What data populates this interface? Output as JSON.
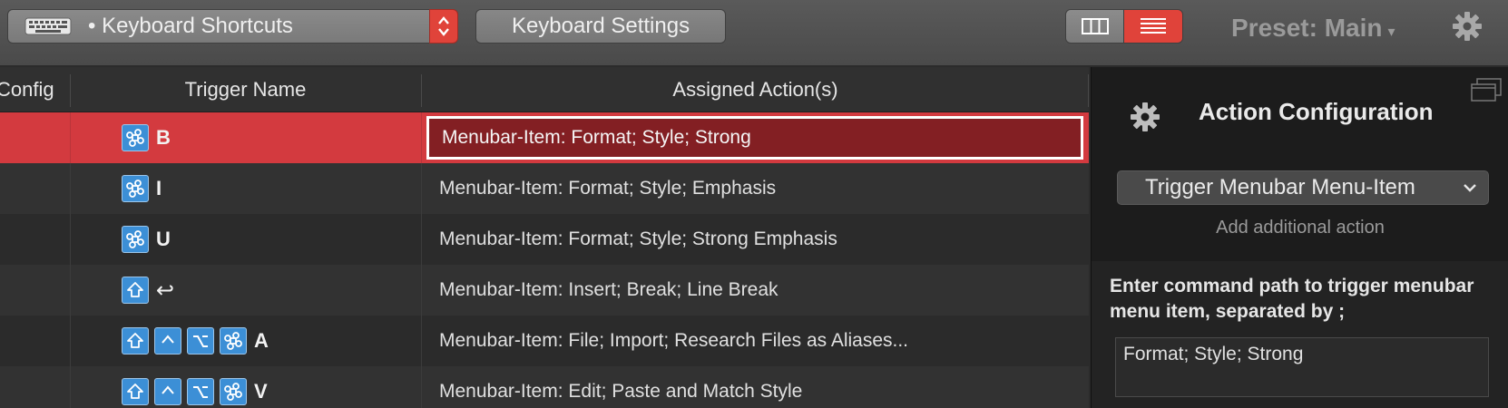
{
  "toolbar": {
    "trigger_type": "• Keyboard Shortcuts",
    "keyboard_settings_label": "Keyboard Settings",
    "preset_label": "Preset: Main",
    "preset_caret": "▾",
    "view_mode_selected": "list"
  },
  "table": {
    "headers": {
      "config": "Config",
      "trigger": "Trigger Name",
      "action": "Assigned Action(s)"
    },
    "rows": [
      {
        "keys": [
          "cmd"
        ],
        "key": "B",
        "action": "Menubar-Item: Format; Style; Strong",
        "selected": true
      },
      {
        "keys": [
          "cmd"
        ],
        "key": "I",
        "action": "Menubar-Item: Format; Style; Emphasis"
      },
      {
        "keys": [
          "cmd"
        ],
        "key": "U",
        "action": "Menubar-Item: Format; Style; Strong Emphasis"
      },
      {
        "keys": [
          "shift"
        ],
        "key": "↩",
        "action": "Menubar-Item: Insert; Break; Line Break"
      },
      {
        "keys": [
          "shift",
          "ctrl",
          "opt",
          "cmd"
        ],
        "key": "A",
        "action": "Menubar-Item: File; Import; Research Files as Aliases..."
      },
      {
        "keys": [
          "shift",
          "ctrl",
          "opt",
          "cmd"
        ],
        "key": "V",
        "action": "Menubar-Item: Edit; Paste and Match Style"
      }
    ]
  },
  "panel": {
    "title": "Action Configuration",
    "action_type": "Trigger Menubar Menu-Item",
    "add_action": "Add additional action",
    "command_label": "Enter command path to trigger menubar menu item, separated by ;",
    "command_value": "Format; Style; Strong"
  },
  "colors": {
    "accent": "#e0433a",
    "selected_row": "#d33a3f",
    "keycap": "#3c8fd6"
  }
}
